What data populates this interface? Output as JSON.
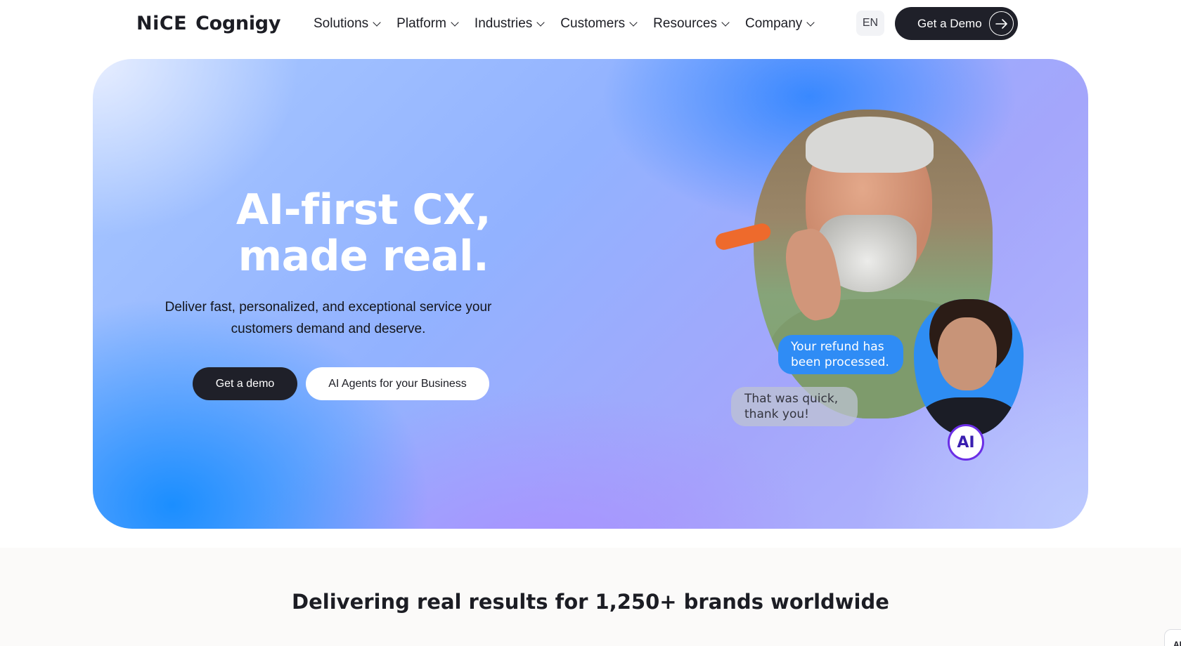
{
  "header": {
    "logo": {
      "brand_part1": "NiCE",
      "brand_part2": "Cognigy"
    },
    "nav": [
      {
        "label": "Solutions"
      },
      {
        "label": "Platform"
      },
      {
        "label": "Industries"
      },
      {
        "label": "Customers"
      },
      {
        "label": "Resources"
      },
      {
        "label": "Company"
      }
    ],
    "language": "EN",
    "demo_button": "Get a Demo"
  },
  "hero": {
    "title_line1": "AI-first CX,",
    "title_line2": "made real.",
    "subtitle_line1": "Deliver fast, personalized, and exceptional service your",
    "subtitle_line2": "customers demand and deserve.",
    "primary_button": "Get a demo",
    "secondary_button": "AI Agents for your Business",
    "chat": {
      "agent_message_line1": "Your refund has",
      "agent_message_line2": "been processed.",
      "customer_message_line1": "That was quick,",
      "customer_message_line2": "thank you!"
    },
    "ai_badge": "AI"
  },
  "results": {
    "headline": "Delivering real results for 1,250+ brands worldwide"
  },
  "widget": {
    "label": "AI"
  },
  "colors": {
    "dark_button": "#1f2029",
    "agent_bubble": "#2f8cf5",
    "badge_ring": "#6b2ee6"
  }
}
